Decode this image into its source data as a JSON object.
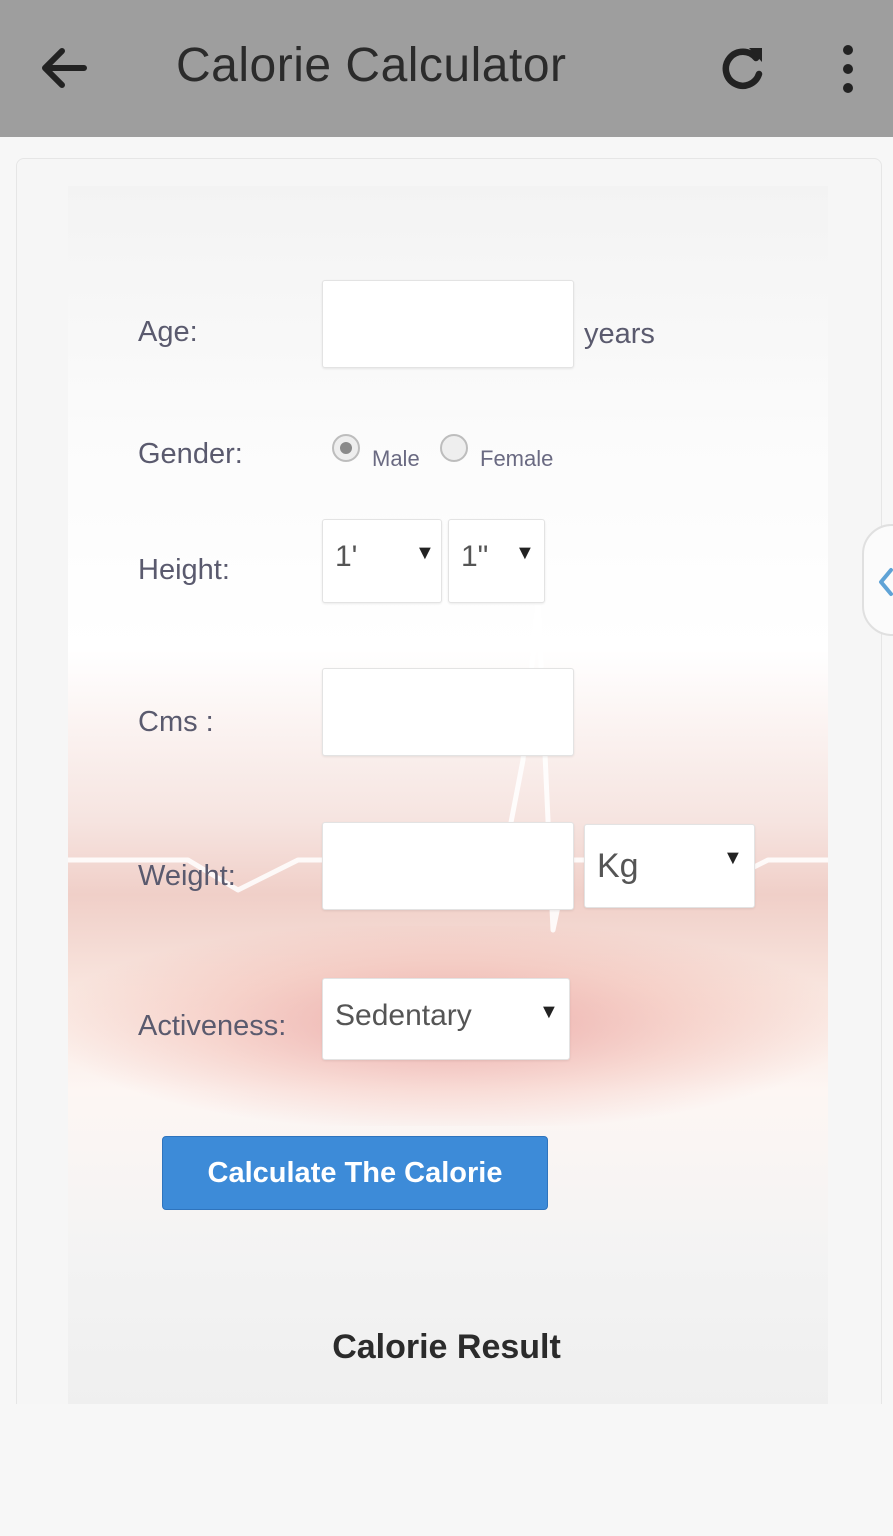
{
  "appbar": {
    "title": "Calorie Calculator",
    "back_icon": "arrow-left-icon",
    "refresh_icon": "refresh-icon",
    "menu_icon": "more-vert-icon",
    "background": "#9e9e9e"
  },
  "form": {
    "age": {
      "label": "Age:",
      "value": "",
      "unit": "years"
    },
    "gender": {
      "label": "Gender:",
      "options": [
        "Male",
        "Female"
      ],
      "selected": "Male"
    },
    "height": {
      "label": "Height:",
      "feet": "1'",
      "inches": "1\""
    },
    "cms": {
      "label": "Cms :",
      "value": ""
    },
    "weight": {
      "label": "Weight:",
      "value": "",
      "unit": "Kg"
    },
    "activeness": {
      "label": "Activeness:",
      "value": "Sedentary"
    },
    "calculate_label": "Calculate The Calorie",
    "button_color": "#3d8bd8"
  },
  "result": {
    "title": "Calorie Result"
  }
}
